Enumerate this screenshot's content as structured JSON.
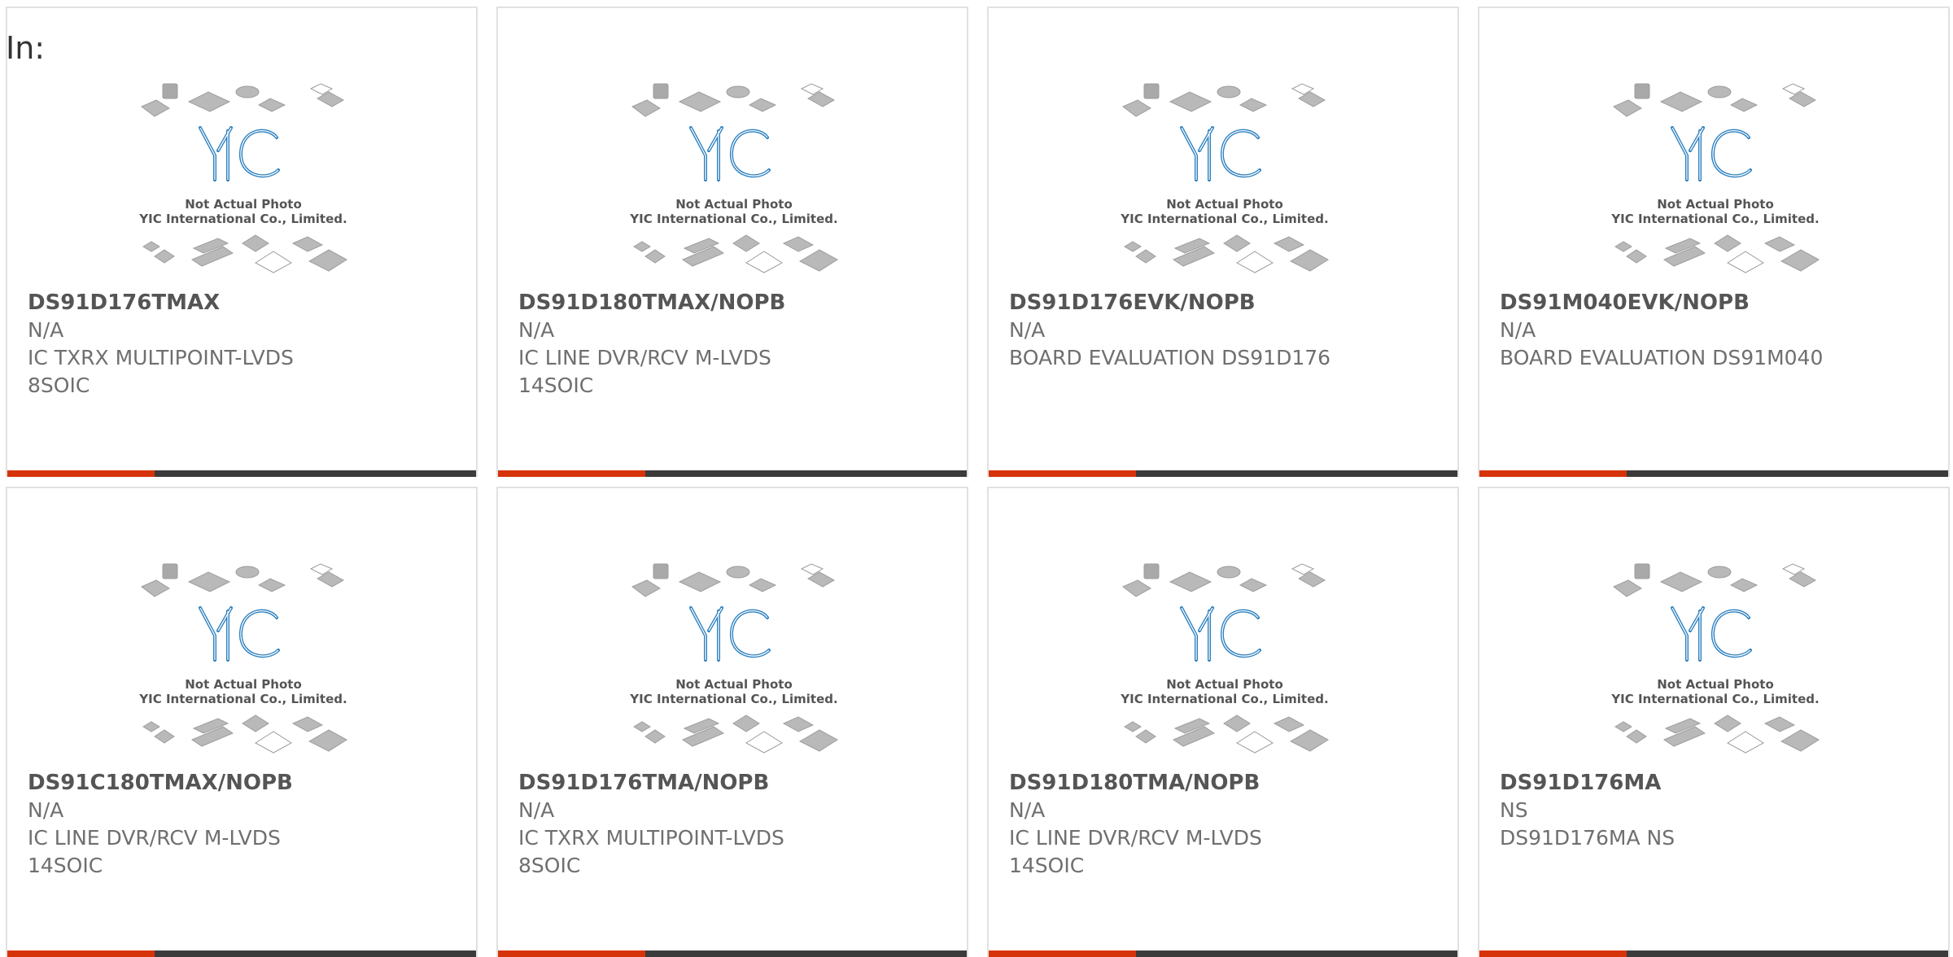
{
  "page": {
    "label": "In:"
  },
  "thumbnail": {
    "caption_line1": "Not Actual Photo",
    "caption_line2": "YIC International Co., Limited.",
    "logo_text": "YIC",
    "icon": "yic-placeholder-photo-icon"
  },
  "colors": {
    "accent": "#d7330b",
    "bar": "#3b3b3b",
    "border": "#e1e1e1",
    "title": "#555555",
    "text": "#6f6f6f",
    "logo": "#2a7fbf"
  },
  "products": [
    {
      "part_number": "DS91D176TMAX",
      "manufacturer": "N/A",
      "description": "IC TXRX MULTIPOINT-LVDS",
      "package": "8SOIC"
    },
    {
      "part_number": "DS91D180TMAX/NOPB",
      "manufacturer": "N/A",
      "description": "IC LINE DVR/RCV M-LVDS",
      "package": "14SOIC"
    },
    {
      "part_number": "DS91D176EVK/NOPB",
      "manufacturer": "N/A",
      "description": "BOARD EVALUATION DS91D176",
      "package": ""
    },
    {
      "part_number": "DS91M040EVK/NOPB",
      "manufacturer": "N/A",
      "description": "BOARD EVALUATION DS91M040",
      "package": ""
    },
    {
      "part_number": "DS91C180TMAX/NOPB",
      "manufacturer": "N/A",
      "description": "IC LINE DVR/RCV M-LVDS",
      "package": "14SOIC"
    },
    {
      "part_number": "DS91D176TMA/NOPB",
      "manufacturer": "N/A",
      "description": "IC TXRX MULTIPOINT-LVDS",
      "package": "8SOIC"
    },
    {
      "part_number": "DS91D180TMA/NOPB",
      "manufacturer": "N/A",
      "description": "IC LINE DVR/RCV M-LVDS",
      "package": "14SOIC"
    },
    {
      "part_number": "DS91D176MA",
      "manufacturer": "NS",
      "description": "DS91D176MA NS",
      "package": ""
    }
  ]
}
